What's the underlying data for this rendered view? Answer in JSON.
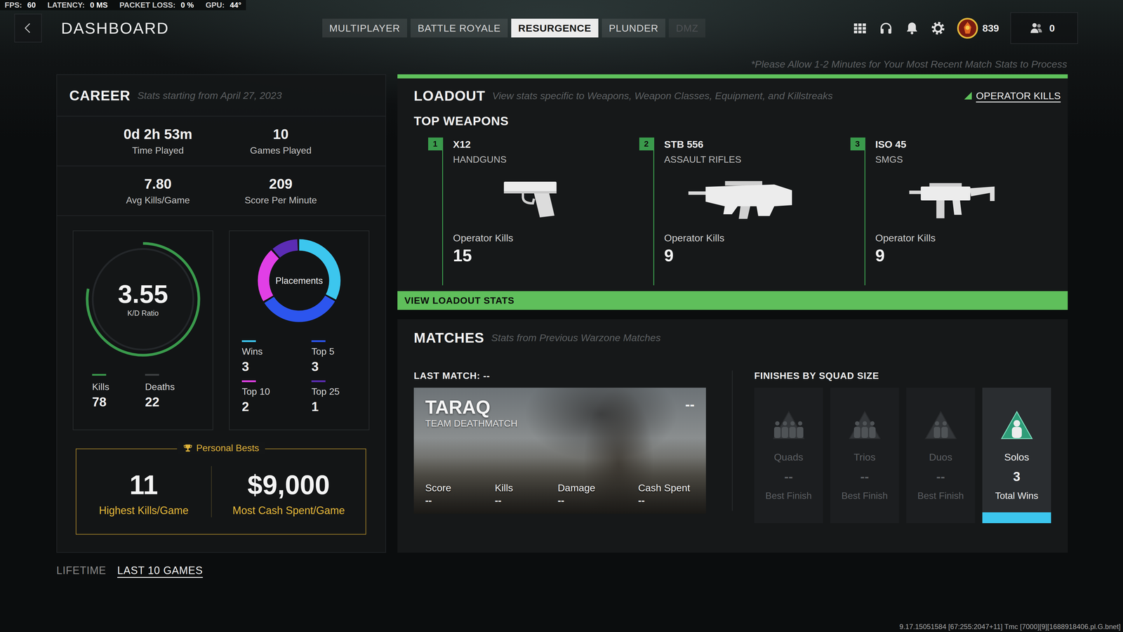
{
  "perf_overlay": [
    {
      "label": "FPS:",
      "value": "60"
    },
    {
      "label": "LATENCY:",
      "value": "0 MS"
    },
    {
      "label": "PACKET LOSS:",
      "value": "0 %"
    },
    {
      "label": "GPU:",
      "value": "44°"
    }
  ],
  "header": {
    "title": "DASHBOARD"
  },
  "mode_tabs": [
    {
      "label": "MULTIPLAYER",
      "selected": false,
      "disabled": false
    },
    {
      "label": "BATTLE ROYALE",
      "selected": false,
      "disabled": false
    },
    {
      "label": "RESURGENCE",
      "selected": true,
      "disabled": false
    },
    {
      "label": "PLUNDER",
      "selected": false,
      "disabled": false
    },
    {
      "label": "DMZ",
      "selected": false,
      "disabled": true
    }
  ],
  "toolbar": {
    "currency": "839",
    "friends_online": "0"
  },
  "notice": "*Please Allow 1-2 Minutes for Your Most Recent Match Stats to Process",
  "career": {
    "title": "CAREER",
    "subtitle": "Stats starting from April 27, 2023",
    "stats": [
      {
        "value": "0d 2h 53m",
        "label": "Time Played"
      },
      {
        "value": "10",
        "label": "Games Played"
      },
      {
        "value": "7.80",
        "label": "Avg Kills/Game"
      },
      {
        "value": "209",
        "label": "Score Per Minute"
      }
    ],
    "kd": {
      "value": "3.55",
      "label": "K/D Ratio",
      "level": 0.78,
      "legend": [
        {
          "label": "Kills",
          "value": "78",
          "color": "#3a9a4c"
        },
        {
          "label": "Deaths",
          "value": "22",
          "color": "#3d4042"
        }
      ]
    },
    "placements": {
      "label": "Placements",
      "items": [
        {
          "label": "Wins",
          "value": "3",
          "count": 3,
          "color": "#3cc6ee"
        },
        {
          "label": "Top 5",
          "value": "3",
          "count": 3,
          "color": "#2c55ee"
        },
        {
          "label": "Top 10",
          "value": "2",
          "count": 2,
          "color": "#e13fe6"
        },
        {
          "label": "Top 25",
          "value": "1",
          "count": 1,
          "color": "#5b2cb4"
        }
      ]
    },
    "personal_bests": {
      "title": "Personal Bests",
      "items": [
        {
          "value": "11",
          "label": "Highest Kills/Game"
        },
        {
          "value": "$9,000",
          "label": "Most Cash Spent/Game"
        }
      ]
    }
  },
  "range_tabs": [
    {
      "label": "LIFETIME",
      "selected": false
    },
    {
      "label": "LAST 10 GAMES",
      "selected": true
    }
  ],
  "loadout": {
    "title": "LOADOUT",
    "subtitle": "View stats specific to Weapons, Weapon Classes, Equipment, and Killstreaks",
    "sort_label": "OPERATOR KILLS",
    "section": "TOP WEAPONS",
    "weapons": [
      {
        "rank": "1",
        "name": "X12",
        "class": "HANDGUNS",
        "stat_label": "Operator Kills",
        "value": "15",
        "kind": "pistol"
      },
      {
        "rank": "2",
        "name": "STB 556",
        "class": "ASSAULT RIFLES",
        "stat_label": "Operator Kills",
        "value": "9",
        "kind": "rifle"
      },
      {
        "rank": "3",
        "name": "ISO 45",
        "class": "SMGS",
        "stat_label": "Operator Kills",
        "value": "9",
        "kind": "smg"
      }
    ],
    "button": "VIEW LOADOUT STATS"
  },
  "matches": {
    "title": "MATCHES",
    "subtitle": "Stats from Previous Warzone Matches",
    "last_match_label": "LAST MATCH: --",
    "last_match": {
      "map": "TARAQ",
      "mode": "TEAM DEATHMATCH",
      "placement": "--",
      "stats": [
        {
          "label": "Score",
          "value": "--"
        },
        {
          "label": "Kills",
          "value": "--"
        },
        {
          "label": "Damage",
          "value": "--"
        },
        {
          "label": "Cash Spent",
          "value": "--"
        }
      ]
    },
    "finishes_title": "FINISHES BY SQUAD SIZE",
    "finishes": [
      {
        "label": "Quads",
        "value": "--",
        "caption": "Best Finish",
        "selected": false
      },
      {
        "label": "Trios",
        "value": "--",
        "caption": "Best Finish",
        "selected": false
      },
      {
        "label": "Duos",
        "value": "--",
        "caption": "Best Finish",
        "selected": false
      },
      {
        "label": "Solos",
        "value": "3",
        "caption": "Total Wins",
        "selected": true
      }
    ]
  },
  "build_info": "9.17.15051584 [67:255:2047+11] Tmc [7000][9][1688918406.pl.G.bnet]"
}
